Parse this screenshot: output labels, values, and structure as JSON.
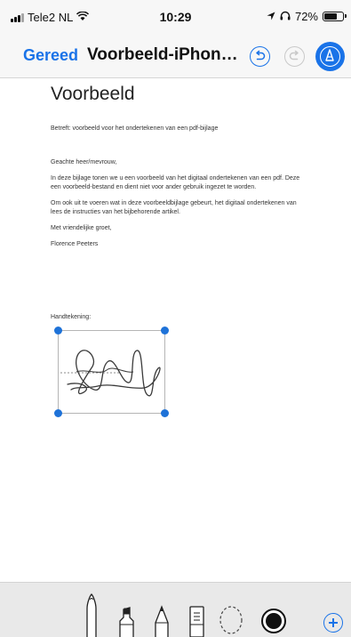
{
  "status_bar": {
    "carrier": "Tele2 NL",
    "time": "10:29",
    "battery": "72%",
    "battery_level": 0.72,
    "icons": [
      "signal-icon",
      "wifi-icon",
      "location-icon",
      "headphones-icon",
      "battery-icon"
    ]
  },
  "nav": {
    "done_label": "Gereed",
    "title": "Voorbeeld-iPhone...",
    "icons": [
      "undo-icon",
      "redo-icon",
      "markup-pen-icon"
    ]
  },
  "document": {
    "heading": "Voorbeeld",
    "subject": "Betreft: voorbeeld voor het ondertekenen van een pdf-bijlage",
    "salutation": "Geachte heer/mevrouw,",
    "paragraph1_line1": "In deze bijlage tonen we u een voorbeeld van het digitaal ondertekenen van een pdf. Deze",
    "paragraph1_line2": "een voorbeeld-bestand en dient niet voor ander gebruik ingezet te worden.",
    "paragraph2_line1": "Om ook uit te voeren wat in deze voorbeeldbijlage gebeurt, het digitaal ondertekenen van",
    "paragraph2_line2": "lees de instructies van het bijbehorende artikel.",
    "closing": "Met vriendelijke groet,",
    "sender": "Florence Peeters",
    "signature_label": "Handtekening:"
  },
  "toolbar": {
    "tools": [
      "pen-tool-icon",
      "marker-tool-icon",
      "pencil-tool-icon",
      "eraser-tool-icon",
      "lasso-tool-icon",
      "color-picker-icon"
    ],
    "selected_color": "#111111",
    "add_icon": "add-icon"
  },
  "colors": {
    "accent": "#1a73e8",
    "handle": "#1e72d8"
  }
}
